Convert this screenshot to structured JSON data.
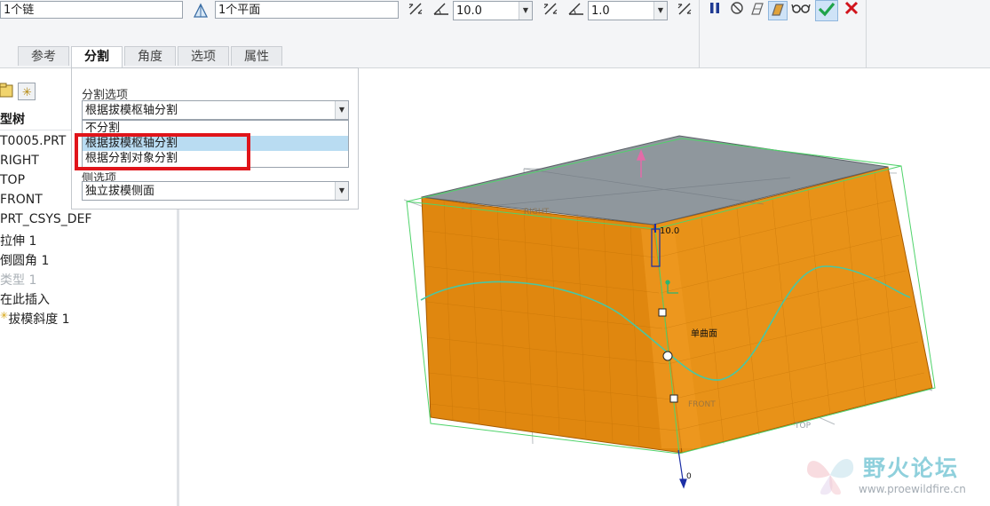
{
  "dashboard": {
    "chain_field": "1个链",
    "plane_field": "1个平面",
    "angle1": "10.0",
    "angle2": "1.0"
  },
  "tabs": [
    "参考",
    "分割",
    "角度",
    "选项",
    "属性"
  ],
  "split_panel": {
    "section_label": "分割选项",
    "selected_value": "根据拔模枢轴分割",
    "options": [
      "不分割",
      "根据拔模枢轴分割",
      "根据分割对象分割"
    ],
    "side_label": "侧选项",
    "side_value": "独立拔模侧面"
  },
  "model_tree": {
    "header": "型树",
    "items": [
      "T0005.PRT",
      "RIGHT",
      "TOP",
      "FRONT",
      "PRT_CSYS_DEF",
      "拉伸 1",
      "倒圆角 1",
      "类型 1",
      "在此插入",
      "拔模斜度 1"
    ]
  },
  "viewport": {
    "label_right": "RIGHT",
    "label_top": "TOP",
    "label_front": "FRONT",
    "label_single": "单曲面",
    "dim_value": "10.0",
    "dim_small": "0"
  },
  "watermark": {
    "title": "野火论坛",
    "url": "www.proewildfire.cn"
  },
  "colors": {
    "model_orange": "#e0870f",
    "top_face": "#8f979d",
    "highlight": "#b9dcf2",
    "red_box": "#e0141a",
    "green_check": "#1fa34a",
    "red_x": "#d1141c"
  }
}
